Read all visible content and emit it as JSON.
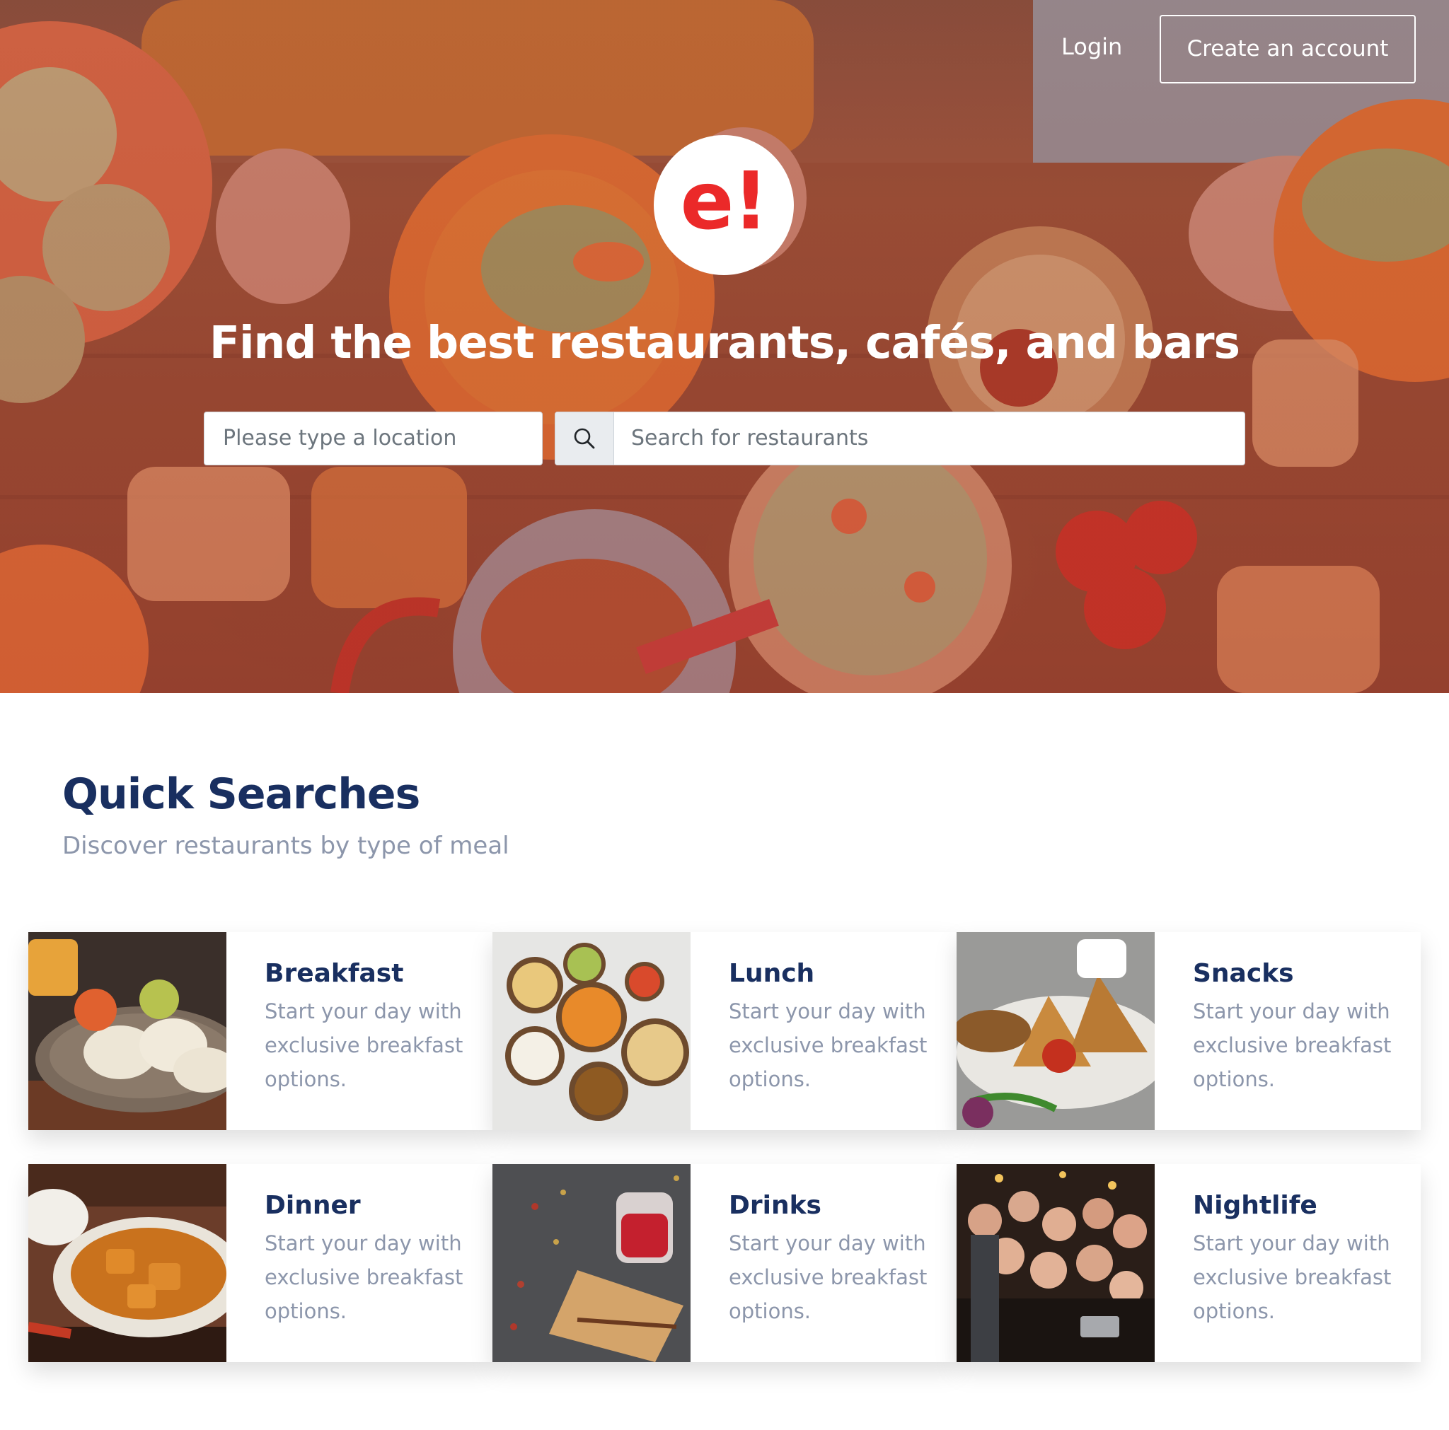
{
  "nav": {
    "login_label": "Login",
    "create_account_label": "Create an account"
  },
  "logo": {
    "text": "e!",
    "color": "#eb2929"
  },
  "hero": {
    "title": "Find the best restaurants, cafés, and bars",
    "location_placeholder": "Please type a location",
    "search_placeholder": "Search for restaurants"
  },
  "quick_searches": {
    "title": "Quick Searches",
    "subtitle": "Discover restaurants by type of meal",
    "cards": [
      {
        "title": "Breakfast",
        "description": "Start your day with exclusive breakfast options."
      },
      {
        "title": "Lunch",
        "description": "Start your day with exclusive breakfast options."
      },
      {
        "title": "Snacks",
        "description": "Start your day with exclusive breakfast options."
      },
      {
        "title": "Dinner",
        "description": "Start your day with exclusive breakfast options."
      },
      {
        "title": "Drinks",
        "description": "Start your day with exclusive breakfast options."
      },
      {
        "title": "Nightlife",
        "description": "Start your day with exclusive breakfast options."
      }
    ]
  },
  "colors": {
    "brand_red": "#eb2929",
    "heading_navy": "#192f60",
    "muted_text": "#8c96ab"
  }
}
